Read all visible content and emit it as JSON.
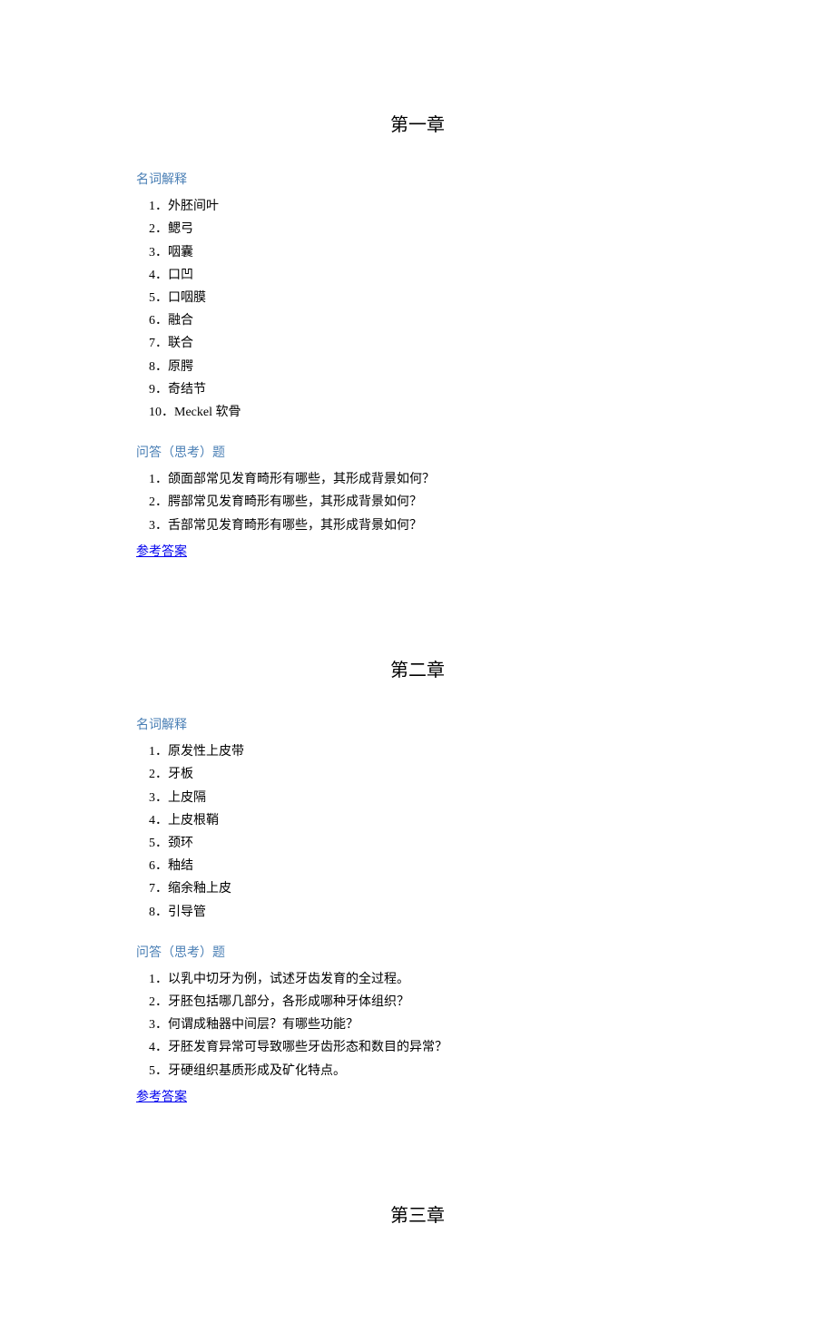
{
  "chapters": [
    {
      "title": "第一章",
      "sections": [
        {
          "heading": "名词解释",
          "items": [
            "1．外胚间叶",
            "2．鳃弓",
            "3．咽囊",
            "4．口凹",
            "5．口咽膜",
            "6．融合",
            "7．联合",
            "8．原腭",
            "9．奇结节",
            "10．Meckel 软骨"
          ]
        },
        {
          "heading": "问答（思考）题",
          "items": [
            "1．颌面部常见发育畸形有哪些，其形成背景如何？",
            "2．腭部常见发育畸形有哪些，其形成背景如何？",
            "3．舌部常见发育畸形有哪些，其形成背景如何？"
          ]
        }
      ],
      "answer_link": "参考答案"
    },
    {
      "title": "第二章",
      "sections": [
        {
          "heading": "名词解释",
          "items": [
            "1．原发性上皮带",
            "2．牙板",
            "3．上皮隔",
            "4．上皮根鞘",
            "5．颈环",
            "6．釉结",
            "7．缩余釉上皮",
            "8．引导管"
          ]
        },
        {
          "heading": "问答（思考）题",
          "items": [
            "1．以乳中切牙为例，试述牙齿发育的全过程。",
            "2．牙胚包括哪几部分，各形成哪种牙体组织？",
            "3．何谓成釉器中间层？有哪些功能？",
            "4．牙胚发育异常可导致哪些牙齿形态和数目的异常？",
            "5．牙硬组织基质形成及矿化特点。"
          ]
        }
      ],
      "answer_link": "参考答案"
    },
    {
      "title": "第三章",
      "sections": [],
      "answer_link": null
    }
  ]
}
